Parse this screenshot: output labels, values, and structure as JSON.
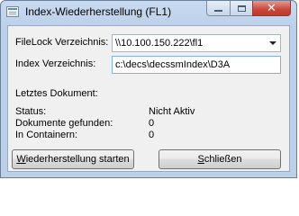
{
  "window": {
    "title": "Index-Wiederherstellung (FL1)",
    "buttons": {
      "minimize": "minimize",
      "maximize": "maximize",
      "close": "close"
    }
  },
  "form": {
    "filelock_label": "FileLock Verzeichnis:",
    "filelock_value": "\\\\10.100.150.222\\fl1",
    "index_label": "Index Verzeichnis:",
    "index_value": "c:\\decs\\decssmIndex\\D3A",
    "last_document_label": "Letztes Dokument:",
    "last_document_value": ""
  },
  "status": {
    "status_label": "Status:",
    "status_value": "Nicht Aktiv",
    "documents_found_label": "Dokumente gefunden:",
    "documents_found_value": "0",
    "in_containers_label": "In Containern:",
    "in_containers_value": "0"
  },
  "actions": {
    "start_label": "Wiederherstellung starten",
    "close_label": "Schließen"
  },
  "icons": {
    "app": "app-window-icon",
    "minimize": "minimize-icon",
    "maximize": "maximize-icon",
    "close": "close-icon",
    "dropdown": "chevron-down-icon"
  }
}
